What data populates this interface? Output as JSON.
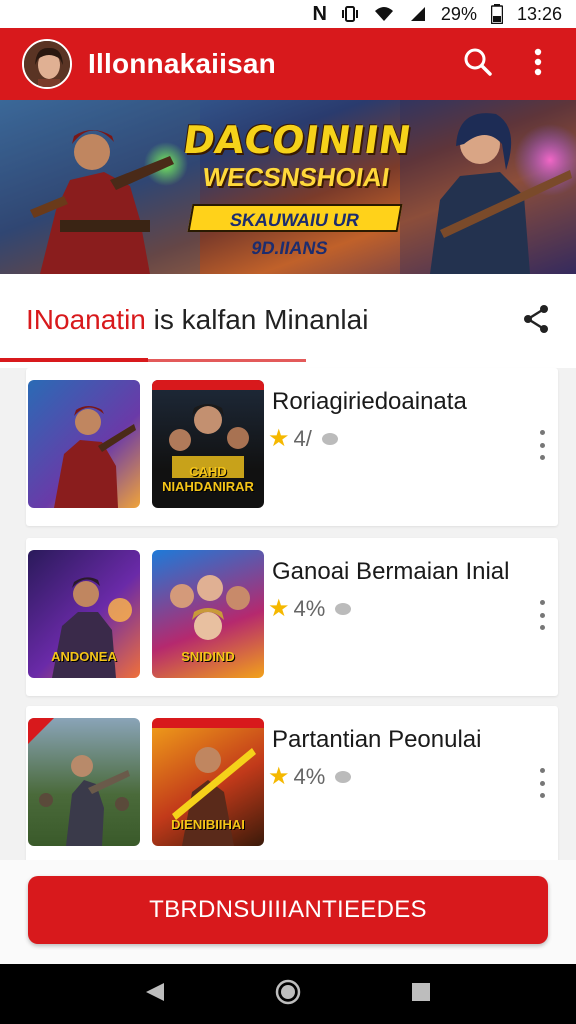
{
  "status_bar": {
    "network": "N",
    "battery": "29%",
    "time": "13:26"
  },
  "app_bar": {
    "title": "Illonnakaiisan"
  },
  "banner": {
    "line1": "DACOINIIN",
    "line2": "WECSNSHOIAI",
    "line3": "SKAUWAIU UR 9D.IIANS"
  },
  "section": {
    "title_accent": "INoanatin",
    "title_rest": "is kalfan  Minanlai"
  },
  "cards": [
    {
      "title": "Roriagiriedoainata",
      "rating": "4/",
      "thumb_b_label": "CAHD NIAHDANIRAR"
    },
    {
      "title": "Ganoai Bermaian Inial",
      "rating": "4%",
      "thumb_a_label": "ANDONEA",
      "thumb_b_label": "SNIDIND"
    },
    {
      "title": "Partantian Peonulai",
      "rating": "4%",
      "thumb_b_label": "DIENIBIIHAI"
    }
  ],
  "cta": {
    "label": "TBRDNSUIIIANTIEEDES"
  },
  "colors": {
    "brand": "#d8191c",
    "star": "#f5b800"
  }
}
